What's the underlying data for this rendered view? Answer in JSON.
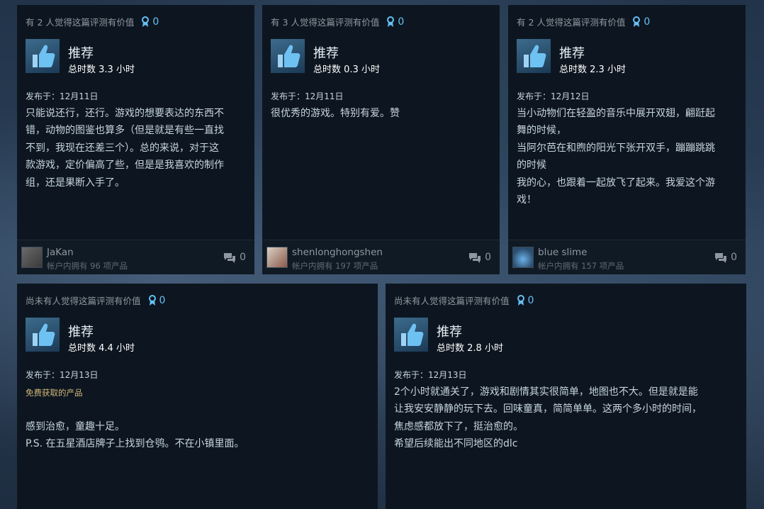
{
  "reviews": [
    {
      "helpful": "有 2 人觉得这篇评测有价值",
      "awards": "0",
      "recommend": "推荐",
      "hours": "总时数 3.3 小时",
      "posted": "发布于：12月11日",
      "free_label": "",
      "body": "只能说还行，还行。游戏的想要表达的东西不\n错，动物的图鉴也算多（但是就是有些一直找\n不到，我现在还差三个）。总的来说，对于这\n款游戏，定价偏高了些，但是是我喜欢的制作\n组，还是果断入手了。",
      "username": "JaKan",
      "owned": "帐户内拥有 96 项产品",
      "comments": "0"
    },
    {
      "helpful": "有 3 人觉得这篇评测有价值",
      "awards": "0",
      "recommend": "推荐",
      "hours": "总时数 0.3 小时",
      "posted": "发布于：12月11日",
      "free_label": "",
      "body": "很优秀的游戏。特别有爱。赞",
      "username": "shenlonghongshen",
      "owned": "帐户内拥有 197 项产品",
      "comments": "0"
    },
    {
      "helpful": "有 2 人觉得这篇评测有价值",
      "awards": "0",
      "recommend": "推荐",
      "hours": "总时数 2.3 小时",
      "posted": "发布于：12月12日",
      "free_label": "",
      "body": "当小动物们在轻盈的音乐中展开双翅，翩跹起\n舞的时候，\n当阿尔芭在和煦的阳光下张开双手，蹦蹦跳跳\n的时候\n我的心，也跟着一起放飞了起来。我爱这个游\n戏！",
      "username": "blue slime",
      "owned": "帐户内拥有 157 项产品",
      "comments": "0"
    },
    {
      "helpful": "尚未有人觉得这篇评测有价值",
      "awards": "0",
      "recommend": "推荐",
      "hours": "总时数 4.4 小时",
      "posted": "发布于：12月13日",
      "free_label": "免费获取的产品",
      "body": "感到治愈，童趣十足。\nP.S. 在五星酒店牌子上找到仓鸮。不在小镇里面。"
    },
    {
      "helpful": "尚未有人觉得这篇评测有价值",
      "awards": "0",
      "recommend": "推荐",
      "hours": "总时数 2.8 小时",
      "posted": "发布于：12月13日",
      "free_label": "",
      "body": "2个小时就通关了，游戏和剧情其实很简单，地图也不大。但是就是能\n让我安安静静的玩下去。回味童真，简简单单。这两个多小时的时间，\n焦虑感都放下了，挺治愈的。\n希望后续能出不同地区的dlc"
    }
  ],
  "icons": {
    "thumbs_up": "thumbs-up-icon",
    "award": "award-icon",
    "comment": "comment-icon"
  },
  "colors": {
    "card_bg": "#0d1620",
    "award_blue": "#66c0f4",
    "free_gold": "#d2b77a"
  }
}
